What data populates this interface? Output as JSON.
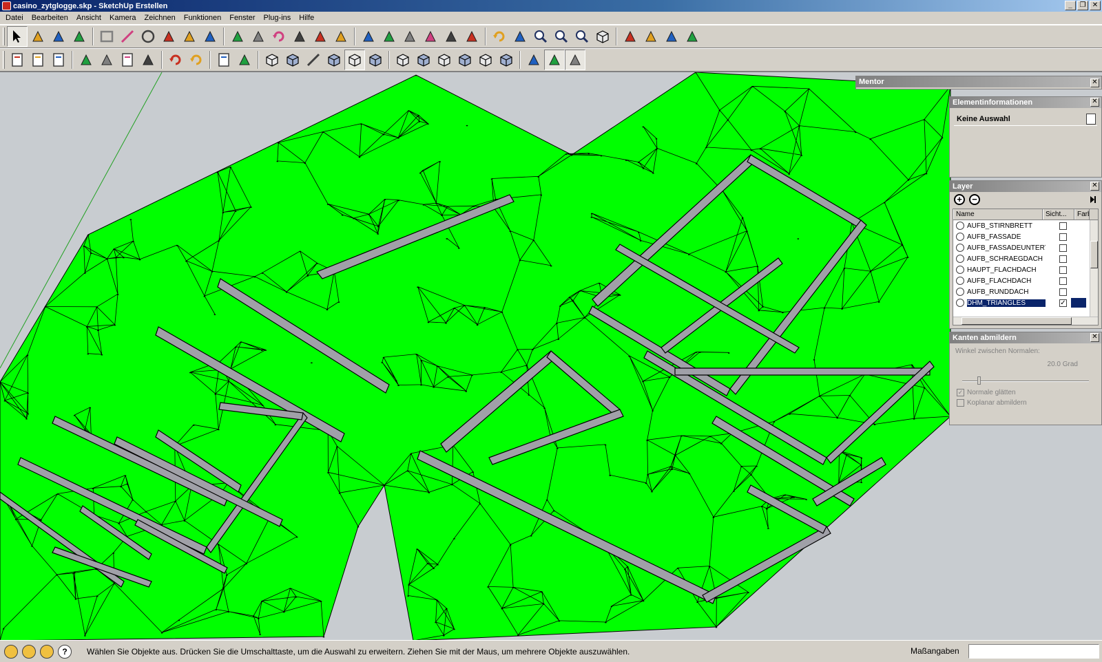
{
  "window": {
    "title": "casino_zytglogge.skp - SketchUp Erstellen",
    "buttons": [
      "_",
      "❐",
      "✕"
    ]
  },
  "menu": [
    "Datei",
    "Bearbeiten",
    "Ansicht",
    "Kamera",
    "Zeichnen",
    "Funktionen",
    "Fenster",
    "Plug-ins",
    "Hilfe"
  ],
  "toolbar1": [
    "select-tool",
    "make-component-tool",
    "paint-bucket-tool",
    "eraser-tool",
    "rectangle-tool",
    "line-tool",
    "circle-tool",
    "arc-tool",
    "polygon-tool",
    "freehand-tool",
    "move-tool",
    "push-pull-tool",
    "rotate-tool",
    "follow-me-tool",
    "scale-tool",
    "offset-tool",
    "tape-measure-tool",
    "dimension-tool",
    "protractor-tool",
    "text-tool",
    "axes-tool",
    "3d-text-tool",
    "orbit-tool",
    "pan-tool",
    "zoom-tool",
    "zoom-window-tool",
    "zoom-extents-tool",
    "previous-view-tool",
    "position-camera-tool",
    "look-around-tool",
    "walk-tool",
    "section-plane-tool"
  ],
  "toolbar2": [
    "new-file",
    "open-file",
    "save-file",
    "cut",
    "copy",
    "paste",
    "delete",
    "undo",
    "redo",
    "print",
    "model-info",
    "xray-style",
    "wireframe-style",
    "hidden-line-style",
    "shaded-style",
    "shaded-texture-style",
    "monochrome-style",
    "iso-view",
    "top-view",
    "front-view",
    "right-view",
    "back-view",
    "left-view",
    "sandbox-1",
    "sandbox-2",
    "sandbox-3"
  ],
  "panels": {
    "mentor": {
      "title": "Mentor"
    },
    "entity": {
      "title": "Elementinformationen",
      "selection": "Keine Auswahl"
    },
    "layer": {
      "title": "Layer",
      "columns": {
        "name": "Name",
        "visible": "Sicht...",
        "color": "Farb"
      },
      "rows": [
        {
          "name": "AUFB_STIRNBRETT",
          "visible": false
        },
        {
          "name": "AUFB_FASSADE",
          "visible": false
        },
        {
          "name": "AUFB_FASSADEUNTERTI",
          "visible": false
        },
        {
          "name": "AUFB_SCHRAEGDACH",
          "visible": false
        },
        {
          "name": "HAUPT_FLACHDACH",
          "visible": false
        },
        {
          "name": "AUFB_FLACHDACH",
          "visible": false
        },
        {
          "name": "AUFB_RUNDDACH",
          "visible": false
        },
        {
          "name": "DHM_TRIANGLES",
          "visible": true,
          "selected": true
        }
      ]
    },
    "soften": {
      "title": "Kanten abmildern",
      "angle_label": "Winkel zwischen Normalen:",
      "angle_value": "20.0  Grad",
      "angle_fraction": 0.12,
      "normals_label": "Normale glätten",
      "normals_checked": true,
      "coplanar_label": "Koplanar abmildern",
      "coplanar_checked": false
    }
  },
  "status": {
    "text": "Wählen Sie Objekte aus. Drücken Sie die Umschalttaste, um die Auswahl zu erweitern. Ziehen Sie mit der Maus, um mehrere Objekte auszuwählen.",
    "measure_label": "Maßangaben",
    "measure_value": "",
    "help_glyph": "?"
  },
  "colors": {
    "terrain": "#00ff00",
    "walls": "#a0a0a8",
    "edges": "#000000",
    "background": "#c8ccd0"
  }
}
